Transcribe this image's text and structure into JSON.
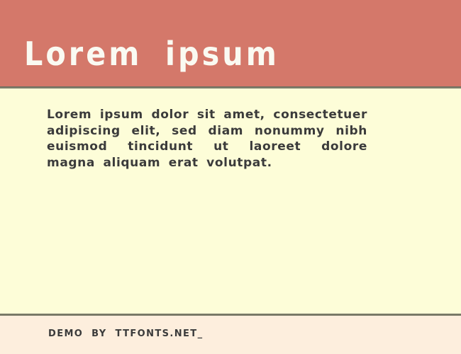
{
  "specimen": {
    "header": {
      "title": "Lorem ipsum",
      "background_color": "#d4786a",
      "text_color": "#fafaf2"
    },
    "divider": {
      "color": "#7d7d6b"
    },
    "body": {
      "sample_text": "Lorem ipsum dolor sit amet, consectetuer adipiscing elit, sed diam nonummy nibh euismod tincidunt ut laoreet dolore magna aliquam erat volutpat.",
      "background_color": "#fdfdd8",
      "text_color": "#3b3b3b"
    },
    "footer": {
      "credit": "Demo by ttfonts.net_",
      "background_color": "#fdeedd",
      "text_color": "#3b3b3b"
    }
  }
}
